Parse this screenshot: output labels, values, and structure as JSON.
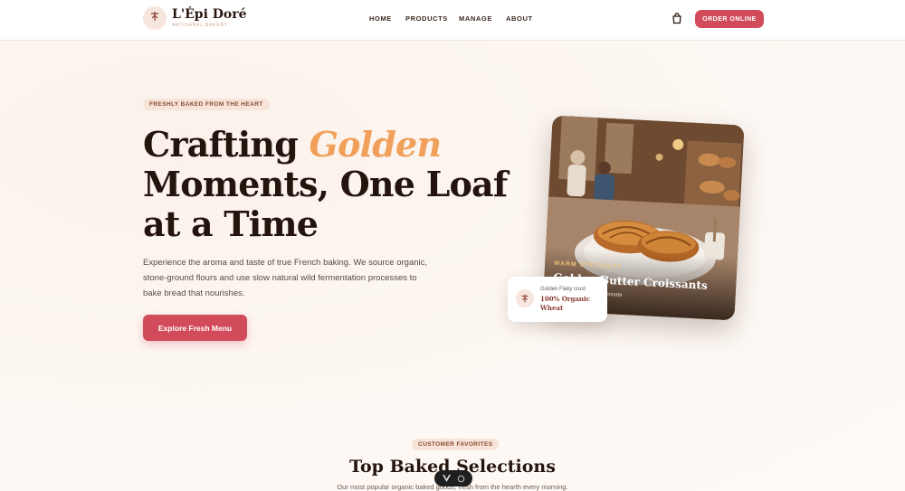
{
  "brand": {
    "name": "L'Épi Doré",
    "tagline": "ARTISANAL BAKERY",
    "logo_icon": "wheat-icon"
  },
  "nav": {
    "items": [
      {
        "label": "HOME"
      },
      {
        "label": "PRODUCTS"
      },
      {
        "label": "MANAGE"
      },
      {
        "label": "ABOUT"
      }
    ],
    "cart_icon": "shopping-bag-icon",
    "order_label": "ORDER ONLINE"
  },
  "hero": {
    "kicker": "FRESHLY BAKED FROM THE HEART",
    "title_part1": "Crafting ",
    "title_highlight": "Golden",
    "title_part2": "Moments, One Loaf at a Time",
    "description": "Experience the aroma and taste of true French baking. We source organic, stone-ground flours and use slow natural wild fermentation processes to bake bread that nourishes.",
    "cta_label": "Explore Fresh Menu"
  },
  "feature_card": {
    "kicker": "WARM SPECIALTY",
    "title": "Golden Butter Croissants",
    "subtitle": "84-layer AOP butter laminate"
  },
  "float_badge": {
    "top": "Golden Flaky crust",
    "main": "100% Organic Wheat"
  },
  "favorites": {
    "kicker": "CUSTOMER FAVORITES",
    "title": "Top Baked Selections",
    "subtitle": "Our most popular organic baked goods, fresh from the hearth every morning."
  },
  "colors": {
    "accent": "#d24b5a",
    "gold": "#f0a05a",
    "text_dark": "#24140e",
    "pill_bg": "#f7e3d7"
  }
}
